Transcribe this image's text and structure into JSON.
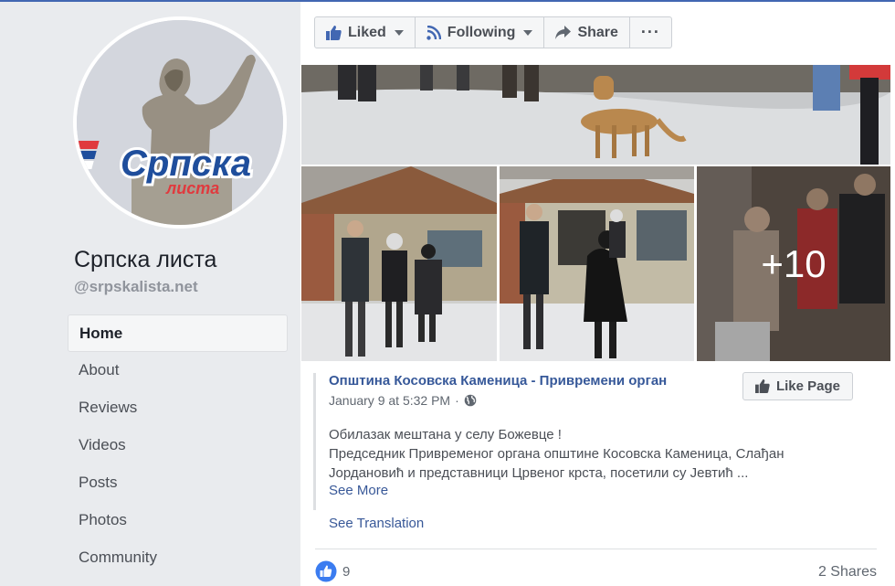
{
  "page": {
    "name": "Српска листа",
    "handle": "@srpskalista.net",
    "logo_text": "Српска",
    "logo_sub": "листа"
  },
  "nav": {
    "items": [
      {
        "label": "Home"
      },
      {
        "label": "About"
      },
      {
        "label": "Reviews"
      },
      {
        "label": "Videos"
      },
      {
        "label": "Posts"
      },
      {
        "label": "Photos"
      },
      {
        "label": "Community"
      }
    ]
  },
  "actions": {
    "liked": "Liked",
    "following": "Following",
    "share": "Share",
    "more": "···"
  },
  "post": {
    "author": "Општина Косовска Каменица - Привремени орган",
    "timestamp": "January 9 at 5:32 PM",
    "separator": "·",
    "like_page": "Like Page",
    "line1": "Обилазак мештана у селу Божевце !",
    "line2": "Председник Привременог органа општине Косовска Каменица, Слађан",
    "line3": "Јордановић и представници Црвеног крста, посетили су Јевтић ...",
    "see_more": "See More",
    "see_translation": "See Translation",
    "more_photos": "+10",
    "like_count": "9",
    "shares": "2 Shares"
  },
  "colors": {
    "brand_blue": "#4267b2",
    "link_blue": "#385898",
    "logo_red": "#e03a3e",
    "logo_blue": "#1f4e9c"
  }
}
